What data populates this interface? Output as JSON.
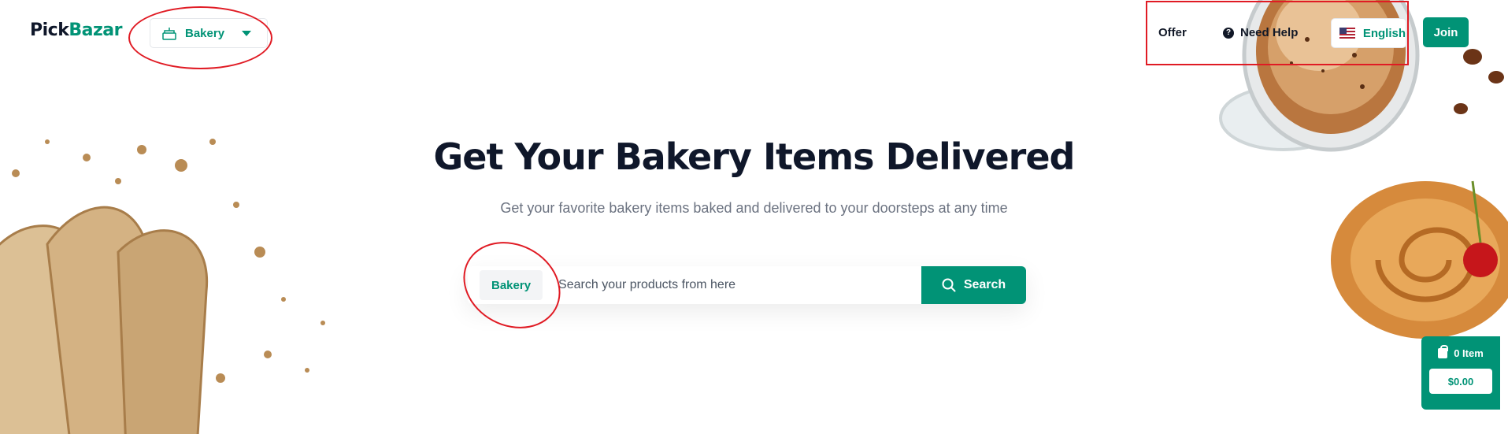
{
  "header": {
    "logo_prefix": "Pick",
    "logo_suffix": "Bazar",
    "shop_selector": {
      "label": "Bakery",
      "icon": "cake-icon"
    },
    "nav": {
      "offer_label": "Offer",
      "help_label": "Need Help",
      "help_icon": "question-icon"
    },
    "language": {
      "label": "English",
      "icon": "us-flag-icon"
    },
    "join_label": "Join"
  },
  "hero": {
    "title": "Get Your Bakery Items Delivered",
    "subtitle": "Get your favorite bakery items baked and delivered to your doorsteps at any time"
  },
  "search": {
    "category_label": "Bakery",
    "placeholder": "Search your products from here",
    "value": "",
    "button_label": "Search",
    "button_icon": "search-icon"
  },
  "cart": {
    "items_label": "0 Item",
    "total": "$0.00",
    "icon": "shopping-bag-icon"
  },
  "colors": {
    "accent": "#019376",
    "title": "#0f172a",
    "annotation": "#e01b24"
  }
}
